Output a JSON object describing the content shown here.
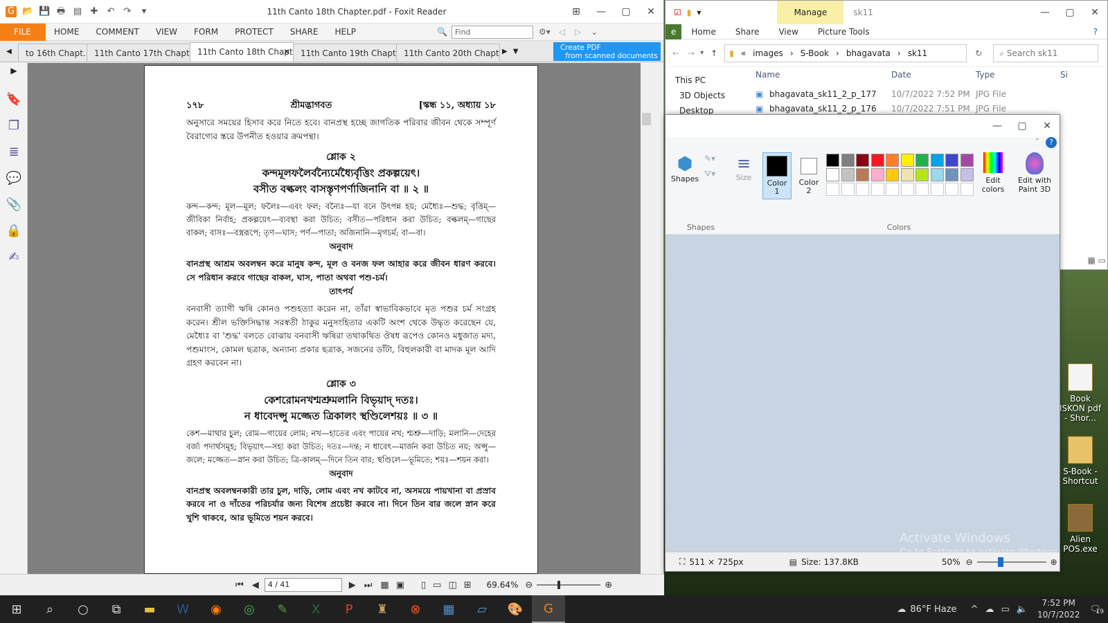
{
  "foxit": {
    "title": "11th Canto 18th Chapter.pdf - Foxit Reader",
    "menu": [
      "FILE",
      "HOME",
      "COMMENT",
      "VIEW",
      "FORM",
      "PROTECT",
      "SHARE",
      "HELP"
    ],
    "find_placeholder": "Find",
    "tabs": [
      "to 16th Chapt...",
      "11th Canto 17th Chapt...",
      "11th Canto 18th Chapter...",
      "11th Canto 19th Chapt...",
      "11th Canto 20th Chapt..."
    ],
    "create_pdf": "Create PDF",
    "create_pdf_sub": "from scanned documents",
    "page_indicator": "4 / 41",
    "zoom": "69.64%"
  },
  "pdf_page": {
    "header_left": "১৭৮",
    "header_center": "শ্রীমদ্ভাগবত",
    "header_right": "[স্কন্ধ ১১, অধ্যায় ১৮",
    "p1": "অনুসারে সময়ের হিসাব করে নিতে হবে। বানপ্রস্থ হচ্ছে জাগতিক পরিবার জীবন থেকে সম্পূর্ণ বৈরাগ্যের স্তরে উপনীত হওয়ার ক্রমপন্থা।",
    "sloka2_title": "শ্লোক ২",
    "sloka2_l1": "কন্দমূলফলৈর্বন্যৈর্মেধ্যৈর্বৃত্তিং প্রকল্পয়েৎ।",
    "sloka2_l2": "বসীত বল্কলং বাসস্তৃণপর্ণাজিনানি বা ॥ ২ ॥",
    "sloka2_syn": "কন্দ—কন্দ; মূল—মূল; ফলৈঃ—এবং ফল; বন্যৈঃ—যা বনে উৎপন্ন হয়; মেধ্যৈঃ—শুদ্ধ; বৃত্তিম্—জীবিকা নির্বাহ; প্রকল্পয়েৎ—ব্যবস্থা করা উচিত; বসীত—পরিধান করা উচিত; বল্কলম্—গাছের বাকল; বাসঃ—বস্ত্ররূপে; তৃণ—ঘাস; পর্ণ—পাতা; অজিনানি—মৃগচর্ম; বা—বা।",
    "anuvad1_title": "অনুবাদ",
    "anuvad1": "বানপ্রস্থ আশ্রম অবলম্বন করে মানুষ কন্দ, মূল ও বনজ ফল আহার করে জীবন ধারণ করবে। সে পরিধান করবে গাছের বাকল, ঘাস, পাতা অথবা পশু-চর্ম।",
    "tatparya_title": "তাৎপর্য",
    "tatparya": "বনবাসী ত্যাগী ঋষি কোনও পশুহত্যা করেন না, তাঁরা স্বাভাবিকভাবে মৃত পশুর চর্ম সংগ্রহ করেন। শ্রীল ভক্তিসিদ্ধান্ত সরস্বতী ঠাকুর মনুসংহিতার একটি অংশ থেকে উদ্ধৃত করেছেন যে, মেধ্যৈঃ বা 'শুদ্ধ' বলতে বোঝায় বনবাসী ঋষিরা তথাকথিত ঔষধ রূপেও কোনও মধুজাত মদ্য, পশুমাংস, কোমল ছত্রাক, অন্যান্য প্রকার ছত্রাক, সজনের ডাঁটা, বিহুলকারী বা মাদক মূল আদি গ্রহণ করবেন না।",
    "sloka3_title": "শ্লোক ৩",
    "sloka3_l1": "কেশরোমনখশ্মশ্রুমলানি বিভৃয়াদ্ দতঃ।",
    "sloka3_l2": "ন ধাবেদপ্সু মজ্জেত ত্রিকালং স্থণ্ডিলেশয়ঃ ॥ ৩ ॥",
    "sloka3_syn": "কেশ—মাথার চুল; রোম—গায়ের লোম; নখ—হাতের এবং পায়ের নখ; শ্মশ্রু—দাড়ি; মলানি—দেহের বর্জ্য পদার্থসমূহ; বিভৃয়াৎ—সহ্য করা উচিত; দতঃ—দন্ত; ন ধাবেৎ—মার্জন করা উচিত নয়; অপ্সু—জলে; মজ্জেত—স্নান করা উচিত; ত্রি-কালম্—দিনে তিন বার; স্থণ্ডিলে—ভূমিতে; শয়ঃ—শয়ন করা।",
    "anuvad2_title": "অনুবাদ",
    "anuvad2": "বানপ্রস্থ অবলম্বনকারী তার চুল, দাড়ি, লোম এবং নখ কাটবে না, অসময়ে পায়খানা বা প্রস্রাব করবে না ও দাঁতের পরিচর্যার জন্য বিশেষ প্রচেষ্টা করবে না। দিনে তিন বার জলে স্নান করে খুশি থাকবে, আর ভূমিতে শয়ন করবে।"
  },
  "explorer": {
    "title": "sk11",
    "manage": "Manage",
    "ribbon": [
      "Home",
      "Share",
      "View",
      "Picture Tools"
    ],
    "file_label": "e",
    "path": [
      "images",
      "S-Book",
      "bhagavata",
      "sk11"
    ],
    "search_placeholder": "Search sk11",
    "nav": [
      "This PC",
      "3D Objects",
      "Desktop"
    ],
    "columns": [
      "Name",
      "Date",
      "Type",
      "Si"
    ],
    "files": [
      {
        "name": "bhagavata_sk11_2_p_177",
        "date": "10/7/2022 7:52 PM",
        "type": "JPG File"
      },
      {
        "name": "bhagavata_sk11_2_p_176",
        "date": "10/7/2022 7:51 PM",
        "type": "JPG File"
      }
    ]
  },
  "paint": {
    "groups": {
      "shapes": "Shapes",
      "colors": "Colors"
    },
    "buttons": {
      "shapes": "Shapes",
      "size": "Size",
      "color1": "Color\n1",
      "color2": "Color\n2",
      "edit_colors": "Edit\ncolors",
      "paint3d": "Edit with\nPaint 3D"
    },
    "color1_label": "Color",
    "color1_num": "1",
    "color2_label": "Color",
    "color2_num": "2",
    "edit_colors_l1": "Edit",
    "edit_colors_l2": "colors",
    "paint3d_l1": "Edit with",
    "paint3d_l2": "Paint 3D",
    "palette": [
      "#000000",
      "#7f7f7f",
      "#880015",
      "#ed1c24",
      "#ff7f27",
      "#fff200",
      "#22b14c",
      "#00a2e8",
      "#3f48cc",
      "#a349a4",
      "#ffffff",
      "#c3c3c3",
      "#b97a57",
      "#ffaec9",
      "#ffc90e",
      "#efe4b0",
      "#b5e61d",
      "#99d9ea",
      "#7092be",
      "#c8bfe7"
    ],
    "dimensions": "511 × 725px",
    "size": "Size: 137.8KB",
    "zoom": "50%"
  },
  "watermark": {
    "line1": "Activate Windows",
    "line2": "Go to Settings to activate Windows."
  },
  "desktop_icons": [
    {
      "label": "Book ISKON pdf - Shor..."
    },
    {
      "label": "S-Book - Shortcut"
    },
    {
      "label": "Alien POS.exe"
    }
  ],
  "taskbar": {
    "weather": "86°F  Haze",
    "time": "7:52 PM",
    "date": "10/7/2022",
    "notif_count": "19"
  }
}
